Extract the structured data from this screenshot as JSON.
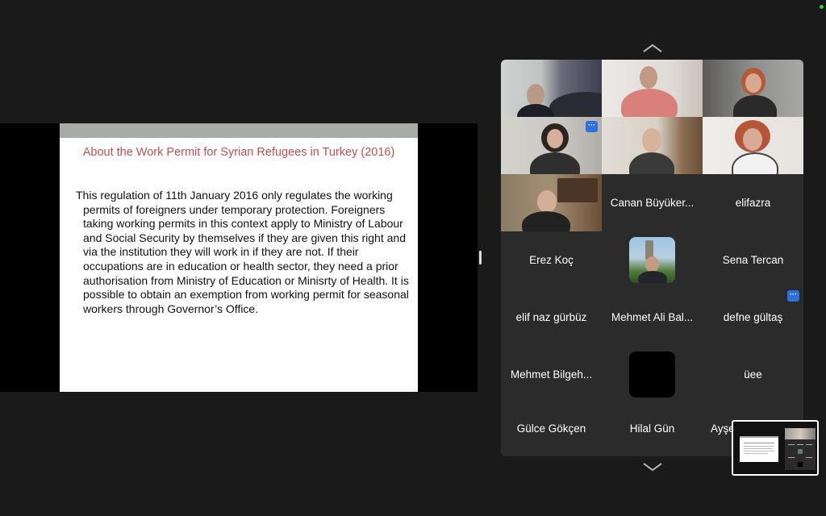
{
  "slide": {
    "title": "About the Work Permit for Syrian Refugees in Turkey (2016)",
    "body": "This regulation of 11th January 2016 only regulates the working permits of foreigners under temporary protection. Foreigners taking working permits in this context apply to Ministry of Labour and Social Security by themselves if they are given this right and via the institution they will work in if they are not. If their occupations are in education or health sector, they need a prior authorisation from Ministry of Education or Minisrty of Health. It is possible to obtain an exemption from working permit for seasonal workers through Governor’s Office."
  },
  "participants": {
    "canan": "Canan Büyüker...",
    "elifazra": "elifazra",
    "erez": "Erez Koç",
    "sena": "Sena Tercan",
    "elifnaz": "elif naz gürbüz",
    "mehmetali": "Mehmet Ali Bal...",
    "defne": "defne gültaş",
    "mehmetb": "Mehmet Bilgeh...",
    "uee": "üee",
    "gulce": "Gülce Gökçen",
    "hilal": "Hilal Gün",
    "ayse": "Ayşe..."
  },
  "badges": {
    "more": "···"
  },
  "colors": {
    "active_speaker": "#4caf50",
    "badge": "#2f6fe0",
    "slide_title": "#c0504d"
  }
}
